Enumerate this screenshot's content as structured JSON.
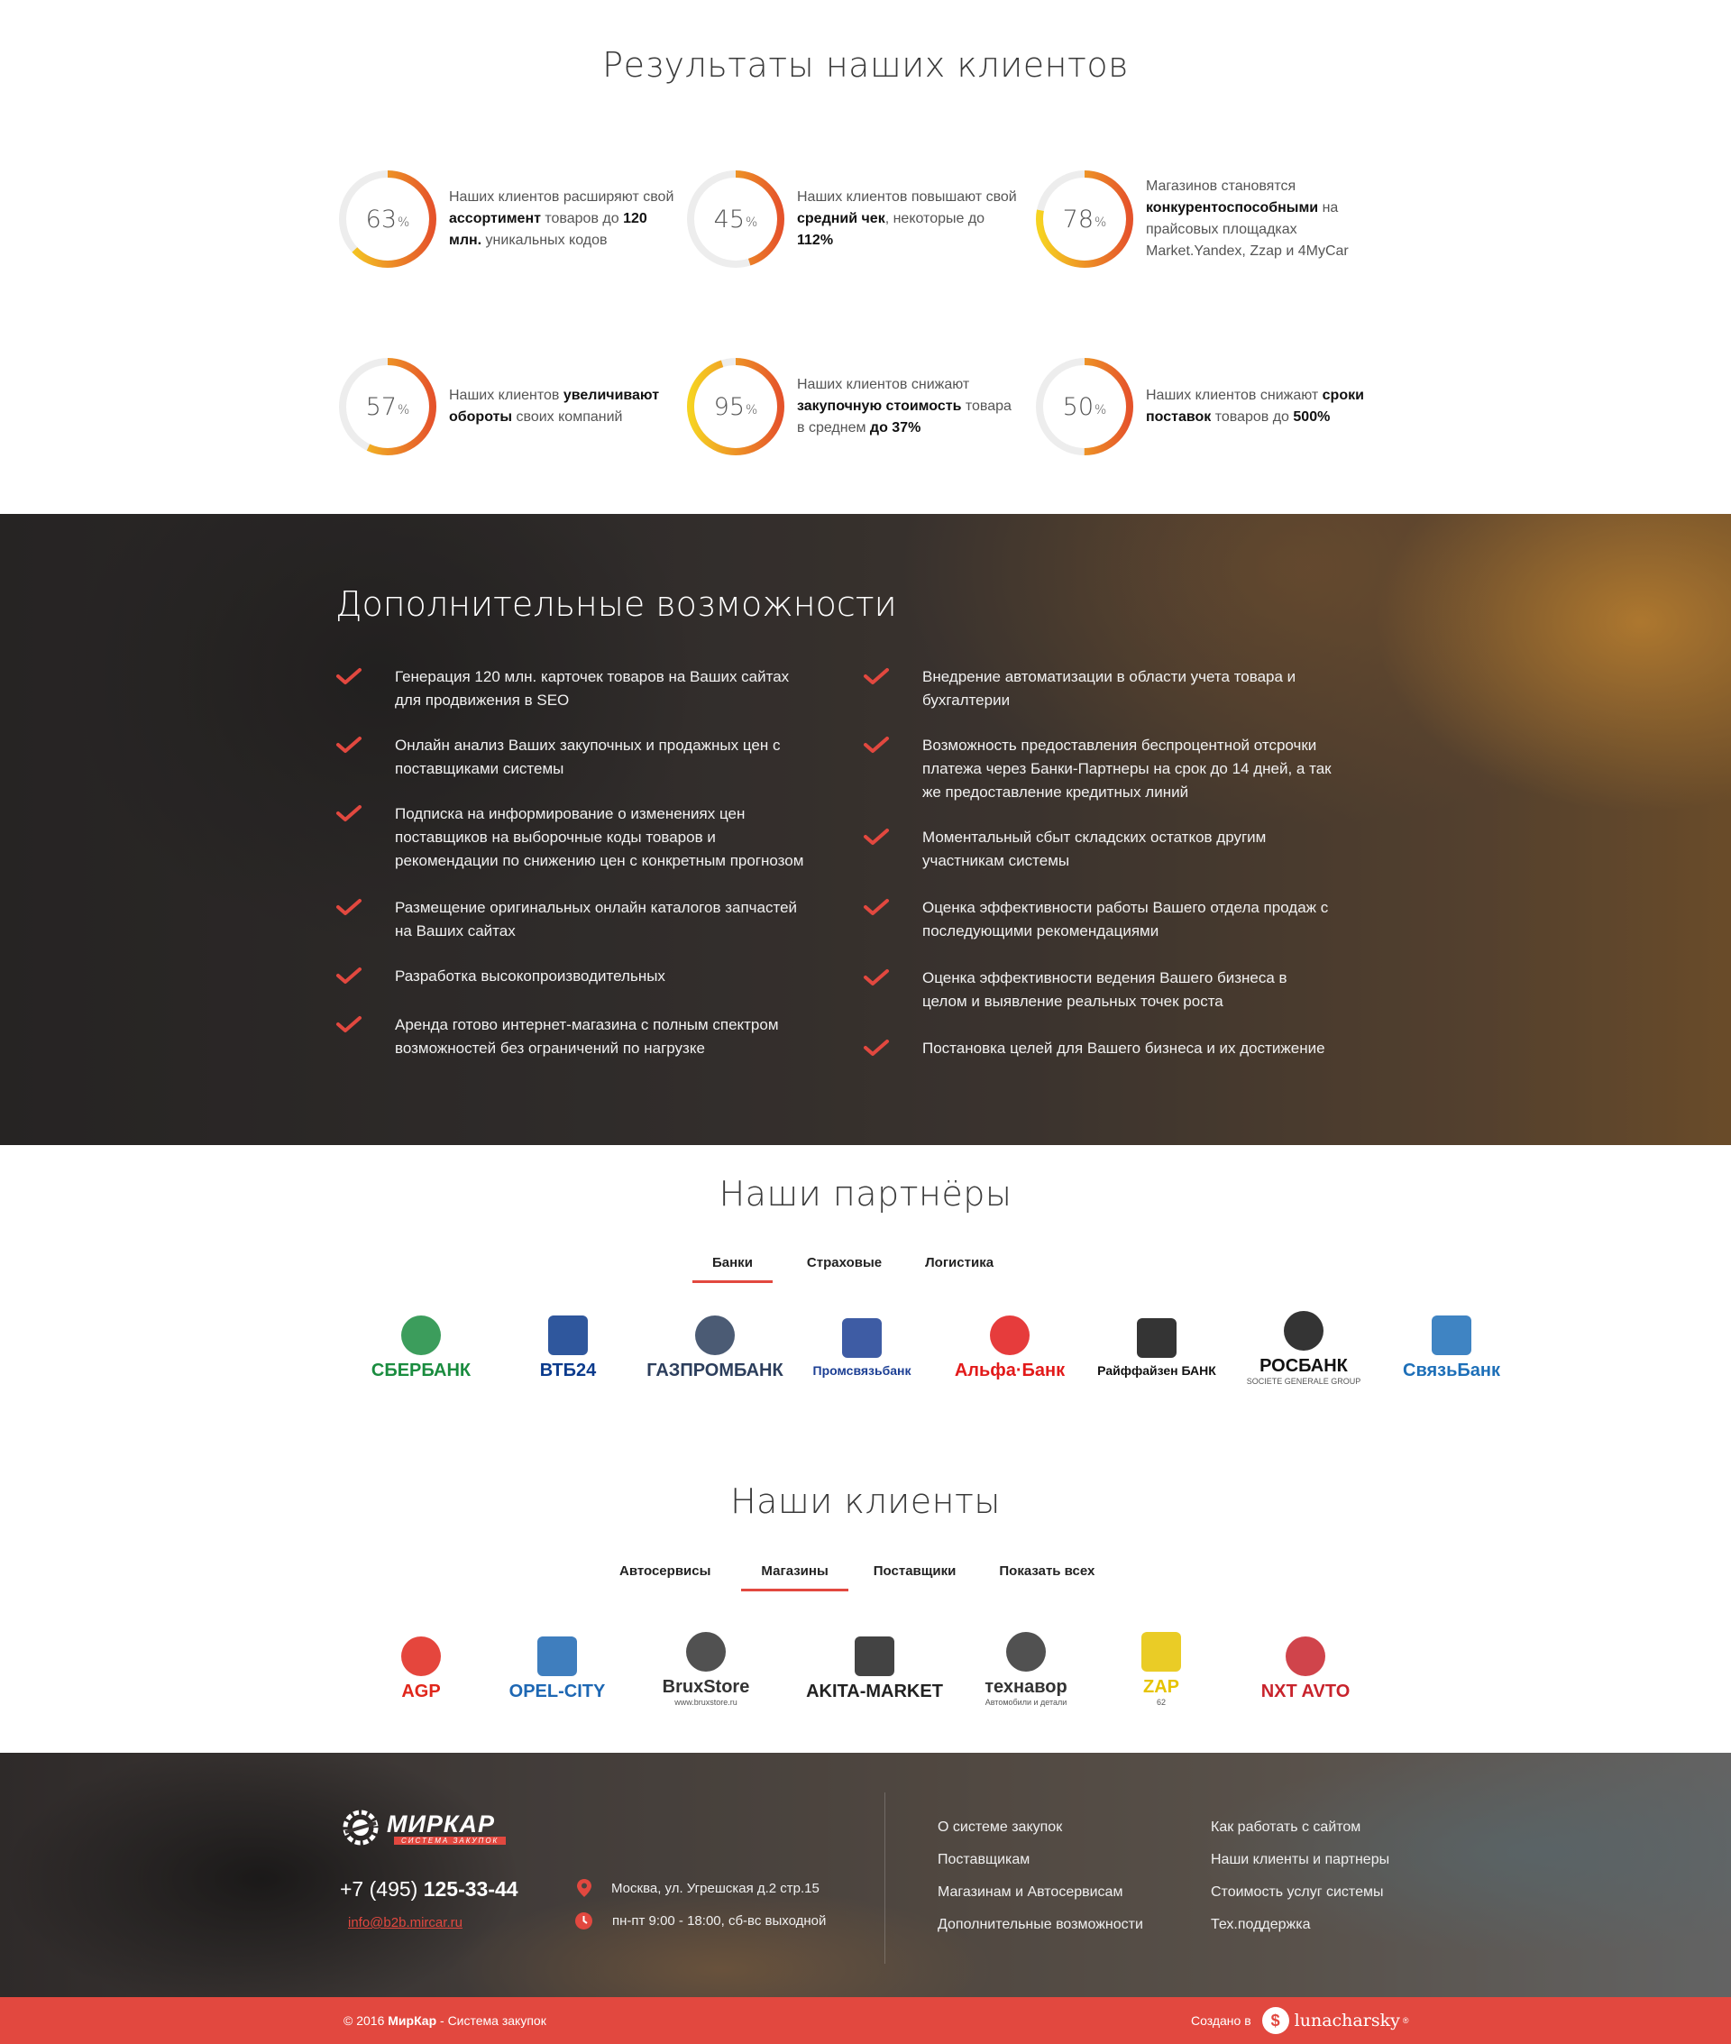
{
  "results": {
    "title": "Результаты наших клиентов",
    "stats": [
      {
        "value": 63,
        "unit": "%",
        "parts": [
          [
            "Наших клиентов расширяют свой ",
            false
          ],
          [
            "ассортимент",
            true
          ],
          [
            " товаров до ",
            false
          ],
          [
            "120 млн.",
            true
          ],
          [
            " уникальных кодов",
            false
          ]
        ]
      },
      {
        "value": 45,
        "unit": "%",
        "parts": [
          [
            "Наших клиентов повышают свой ",
            false
          ],
          [
            "средний чек",
            true
          ],
          [
            ", некоторые до ",
            false
          ],
          [
            "112%",
            true
          ]
        ]
      },
      {
        "value": 78,
        "unit": "%",
        "parts": [
          [
            "Магазинов становятся ",
            false
          ],
          [
            "конкурентоспособными",
            true
          ],
          [
            " на прайсовых площадках Market.Yandex, Zzap и 4MyCar",
            false
          ]
        ]
      },
      {
        "value": 57,
        "unit": "%",
        "parts": [
          [
            "Наших клиентов ",
            false
          ],
          [
            "увеличивают обороты",
            true
          ],
          [
            " своих компаний",
            false
          ]
        ]
      },
      {
        "value": 95,
        "unit": "%",
        "parts": [
          [
            "Наших клиентов снижают ",
            false
          ],
          [
            "закупочную стоимость",
            true
          ],
          [
            " товара в среднем ",
            false
          ],
          [
            "до 37%",
            true
          ]
        ]
      },
      {
        "value": 50,
        "unit": "%",
        "parts": [
          [
            "Наших клиентов снижают ",
            false
          ],
          [
            "сроки поставок",
            true
          ],
          [
            " товаров до ",
            false
          ],
          [
            "500%",
            true
          ]
        ]
      }
    ]
  },
  "features": {
    "title": "Дополнительные возможности",
    "left": [
      "Генерация 120 млн. карточек товаров на Ваших сайтах для продвижения в SEO",
      "Онлайн анализ Ваших закупочных и продажных цен с поставщиками системы",
      "Подписка на информирование о изменениях цен поставщиков на выборочные коды товаров и рекомендации по снижению цен с конкретным прогнозом",
      "Размещение оригинальных онлайн каталогов запчастей на Ваших сайтах",
      "Разработка высокопроизводительных",
      "Аренда готово интернет-магазина с полным спектром возможностей без ограничений по нагрузке"
    ],
    "right": [
      "Внедрение автоматизации в области учета товара и бухгалтерии",
      "Возможность предоставления беспроцентной отсрочки платежа через Банки-Партнеры на срок до 14 дней, а так же предоставление кредитных линий",
      "Моментальный сбыт складских остатков другим участникам системы",
      "Оценка эффективности работы Вашего отдела продаж с последующими рекомендациями",
      "Оценка эффективности ведения Вашего бизнеса в целом и выявление реальных точек роста",
      "Постановка целей для Вашего бизнеса и их достижение"
    ]
  },
  "partners": {
    "title": "Наши партнёры",
    "tabs": [
      "Банки",
      "Страховые",
      "Логистика"
    ],
    "logos": [
      {
        "name": "СБЕРБАНК",
        "color": "#1a8c3f"
      },
      {
        "name": "ВТБ24",
        "color": "#0a3a8c"
      },
      {
        "name": "ГАЗПРОМБАНК",
        "color": "#2c3e5c"
      },
      {
        "name": "Промсвязьбанк",
        "color": "#1c3f94"
      },
      {
        "name": "Альфа·Банк",
        "color": "#e21a1a"
      },
      {
        "name": "Райффайзен БАНК",
        "color": "#111111"
      },
      {
        "name": "РОСБАНК",
        "color": "#111111",
        "sub": "SOCIETE GENERALE GROUP"
      },
      {
        "name": "СвязьБанк",
        "color": "#1d6fb8"
      }
    ]
  },
  "clients": {
    "title": "Наши клиенты",
    "tabs": [
      "Автосервисы",
      "Магазины",
      "Поставщики",
      "Показать всех"
    ],
    "logos": [
      {
        "name": "AGP",
        "color": "#e0261b"
      },
      {
        "name": "OPEL-CITY",
        "color": "#1d67b3"
      },
      {
        "name": "BruxStore",
        "color": "#333333",
        "sub": "www.bruxstore.ru"
      },
      {
        "name": "AKITA-MARKET",
        "color": "#222222"
      },
      {
        "name": "технавор",
        "color": "#333333",
        "sub": "Автомобили и детали"
      },
      {
        "name": "ZAP",
        "color": "#e6c300",
        "sub": "62"
      },
      {
        "name": "NXT AVTO",
        "color": "#c8232c"
      }
    ]
  },
  "footer": {
    "logo_text": "МИРКАР",
    "logo_sub": "СИСТЕМА ЗАКУПОК",
    "phone_prefix": "+7 (495) ",
    "phone_main": "125-33-44",
    "email": "info@b2b.mircar.ru",
    "address": "Москва, ул. Угрешская д.2 стр.15",
    "hours": "пн-пт 9:00 - 18:00, сб-вс выходной",
    "links_col1": [
      "О системе закупок",
      "Поставщикам",
      "Магазинам и Автосервисам",
      "Дополнительные возможности"
    ],
    "links_col2": [
      "Как работать с сайтом",
      "Наши клиенты и партнеры",
      "Стоимость услуг системы",
      "Тех.поддержка"
    ]
  },
  "bottom": {
    "copyright_prefix": "© 2016 ",
    "brand": "МирКар",
    "copyright_suffix": " - Система закупок",
    "made_in": "Создано в",
    "studio": "lunacharsky",
    "reg": "®"
  },
  "colors": {
    "accent": "#e2483f",
    "ring_start": "#f6d321",
    "ring_end": "#e5532b",
    "check": "#e2483f"
  }
}
